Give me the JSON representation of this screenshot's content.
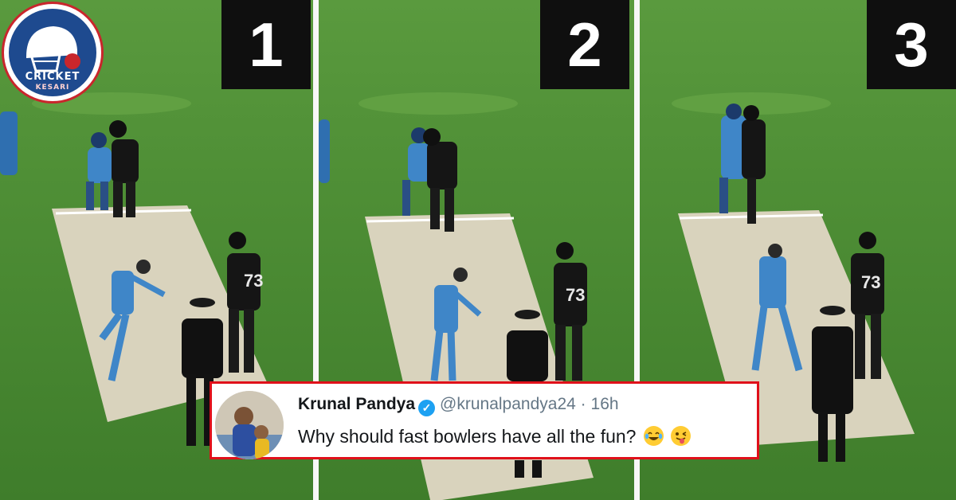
{
  "logo": {
    "word1": "CRICKET",
    "word2": "KESARI"
  },
  "panels": [
    {
      "number": "1",
      "jersey": "73"
    },
    {
      "number": "2",
      "jersey": "73"
    },
    {
      "number": "3",
      "jersey": "73"
    }
  ],
  "tweet": {
    "name": "Krunal Pandya",
    "handle": "@krunalpandya24",
    "separator": "·",
    "time": "16h",
    "text": "Why should fast bowlers have all the fun?",
    "emojis": [
      "face-with-tears-of-joy",
      "winking-face-with-tongue"
    ]
  },
  "colors": {
    "grass": "#4f8f36",
    "pitch": "#d9d3bd",
    "india_kit": "#3f86c8",
    "nz_kit": "#151515",
    "tweet_border": "#e0101a",
    "verified": "#1da1f2",
    "logo_blue": "#1e4a8f",
    "logo_red": "#c9262c"
  }
}
